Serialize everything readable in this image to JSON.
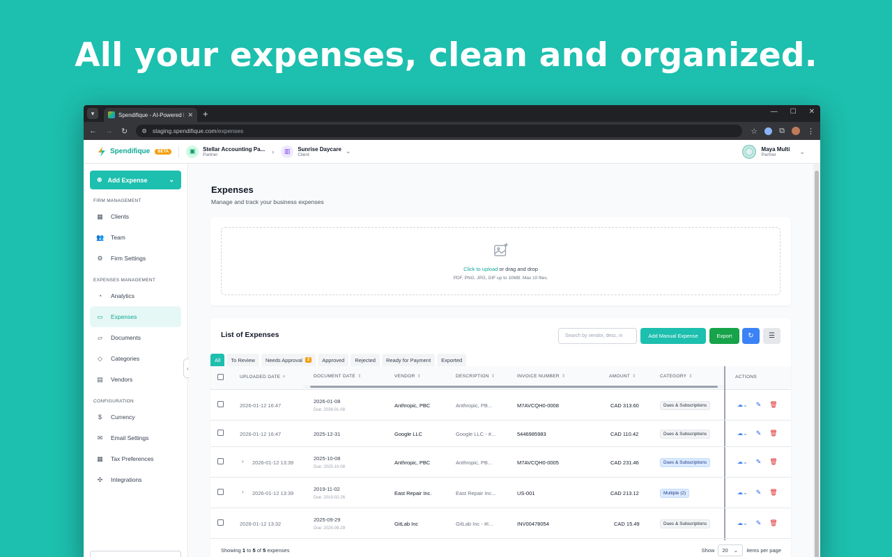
{
  "headline": "All your expenses, clean and organized.",
  "browser": {
    "tab_title": "Spendifique - AI-Powered Busi",
    "url_host": "staging.spendifique.com",
    "url_path": "/expenses"
  },
  "app": {
    "logo_text": "Spendifique",
    "beta_label": "BETA",
    "firm": {
      "name": "Stellar Accounting Pa...",
      "role": "Partner"
    },
    "client": {
      "name": "Sunrise Daycare",
      "role": "Client"
    },
    "user": {
      "name": "Maya Multi",
      "role": "Partner"
    },
    "accent_color": "#1dbfae"
  },
  "sidebar": {
    "add_expense_label": "Add Expense",
    "sections": [
      {
        "title": "FIRM MANAGEMENT",
        "items": [
          {
            "label": "Clients",
            "icon": "building-icon"
          },
          {
            "label": "Team",
            "icon": "users-icon"
          },
          {
            "label": "Firm Settings",
            "icon": "gear-icon"
          }
        ]
      },
      {
        "title": "EXPENSES MANAGEMENT",
        "items": [
          {
            "label": "Analytics",
            "icon": "pie-chart-icon"
          },
          {
            "label": "Expenses",
            "icon": "receipt-icon"
          },
          {
            "label": "Documents",
            "icon": "folder-icon"
          },
          {
            "label": "Categories",
            "icon": "tag-icon"
          },
          {
            "label": "Vendors",
            "icon": "store-icon"
          }
        ]
      },
      {
        "title": "CONFIGURATION",
        "items": [
          {
            "label": "Currency",
            "icon": "dollar-icon"
          },
          {
            "label": "Email Settings",
            "icon": "mail-icon"
          },
          {
            "label": "Tax Preferences",
            "icon": "calculator-icon"
          },
          {
            "label": "Integrations",
            "icon": "puzzle-icon"
          }
        ]
      }
    ]
  },
  "page": {
    "title": "Expenses",
    "subtitle": "Manage and track your business expenses"
  },
  "upload": {
    "link_text": "Click to upload",
    "rest_text": " or drag and drop",
    "hint": "PDF, PNG, JPG, GIF up to 10MB. Max 10 files."
  },
  "list": {
    "title": "List of Expenses",
    "search_placeholder": "Search by vendor, desc, in",
    "add_manual_label": "Add Manual Expense",
    "export_label": "Export",
    "tabs": [
      {
        "label": "All"
      },
      {
        "label": "To Review"
      },
      {
        "label": "Needs Approval",
        "count": "2"
      },
      {
        "label": "Approved"
      },
      {
        "label": "Rejected"
      },
      {
        "label": "Ready for Payment"
      },
      {
        "label": "Exported"
      }
    ],
    "columns": {
      "uploaded_date": "UPLOADED DATE",
      "document_date": "DOCUMENT DATE",
      "vendor": "VENDOR",
      "description": "DESCRIPTION",
      "invoice_number": "INVOICE NUMBER",
      "amount": "AMOUNT",
      "category": "CATEGORY",
      "actions": "ACTIONS"
    },
    "rows": [
      {
        "uploaded": "2026-01-12 16:47",
        "doc_date": "2026-01-08",
        "due": "Due: 2026-01-08",
        "vendor": "Anthropic, PBC",
        "description": "Anthropic, PB...",
        "invoice": "M7AVCQH0-0008",
        "amount": "CAD 313.60",
        "category": "Dues & Subscriptions",
        "category_style": "gray",
        "expandable": false
      },
      {
        "uploaded": "2026-01-12 16:47",
        "doc_date": "2025-12-31",
        "due": "",
        "vendor": "Google LLC",
        "description": "Google LLC - #...",
        "invoice": "5446985983",
        "amount": "CAD 110.42",
        "category": "Dues & Subscriptions",
        "category_style": "gray",
        "expandable": false
      },
      {
        "uploaded": "2026-01-12 13:39",
        "doc_date": "2025-10-08",
        "due": "Due: 2025-10-08",
        "vendor": "Anthropic, PBC",
        "description": "Anthropic, PB...",
        "invoice": "M7AVCQH0-0005",
        "amount": "CAD 231.46",
        "category": "Dues & Subscriptions",
        "category_style": "blue",
        "expandable": true
      },
      {
        "uploaded": "2026-01-12 13:39",
        "doc_date": "2019-11-02",
        "due": "Due: 2019-02-26",
        "vendor": "East Repair Inc.",
        "description": "East Repair Inc...",
        "invoice": "US-001",
        "amount": "CAD 213.12",
        "category": "Multiple (2)",
        "category_style": "blue",
        "expandable": true
      },
      {
        "uploaded": "2026-01-12 13:32",
        "doc_date": "2025-09-29",
        "due": "Due: 2025-09-29",
        "vendor": "GitLab Inc",
        "description": "GitLab Inc - #I...",
        "invoice": "INV00478054",
        "amount": "CAD 15.49",
        "category": "Dues & Subscriptions",
        "category_style": "gray",
        "expandable": false
      }
    ],
    "footer": {
      "prefix": "Showing ",
      "from": "1",
      "to_word": " to ",
      "to": "5",
      "of_word": " of ",
      "total": "5",
      "suffix": " expenses"
    },
    "show_label": "Show",
    "page_size": "20",
    "per_page_label": "items per page"
  }
}
